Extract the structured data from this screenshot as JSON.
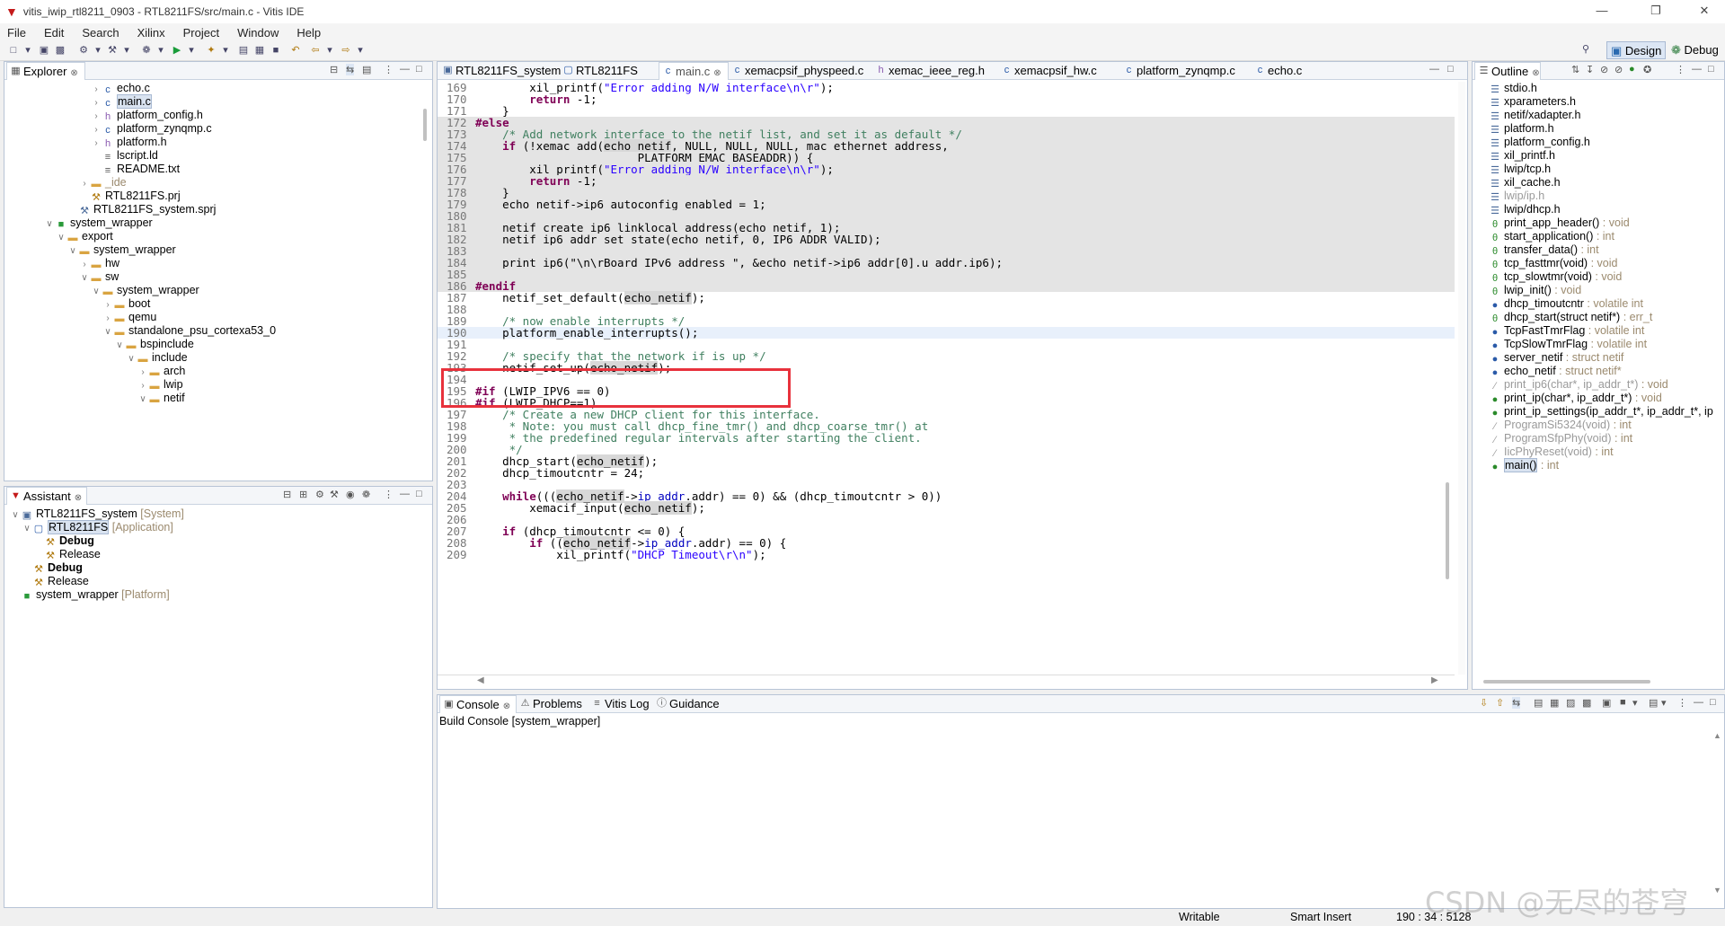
{
  "window": {
    "title": "vitis_iwip_rtl8211_0903 - RTL8211FS/src/main.c - Vitis IDE"
  },
  "menu": [
    "File",
    "Edit",
    "Search",
    "Xilinx",
    "Project",
    "Window",
    "Help"
  ],
  "perspectives": {
    "design": "Design",
    "debug": "Debug"
  },
  "explorer": {
    "tab": "Explorer",
    "rows": [
      {
        "label": "echo.c",
        "indent": 4,
        "twisty": ">",
        "icon": "c-file-icon"
      },
      {
        "label": "main.c",
        "indent": 4,
        "twisty": ">",
        "icon": "c-file-icon",
        "selected": true
      },
      {
        "label": "platform_config.h",
        "indent": 4,
        "twisty": ">",
        "icon": "h-file-icon"
      },
      {
        "label": "platform_zynqmp.c",
        "indent": 4,
        "twisty": ">",
        "icon": "c-file-icon"
      },
      {
        "label": "platform.h",
        "indent": 4,
        "twisty": ">",
        "icon": "h-file-icon"
      },
      {
        "label": "lscript.ld",
        "indent": 4,
        "twisty": "",
        "icon": "linker-file-icon"
      },
      {
        "label": "README.txt",
        "indent": 4,
        "twisty": "",
        "icon": "text-file-icon"
      },
      {
        "label": "_ide",
        "indent": 3,
        "twisty": ">",
        "icon": "folder-icon",
        "gray": true
      },
      {
        "label": "RTL8211FS.prj",
        "indent": 3,
        "twisty": "",
        "icon": "project-file-icon"
      },
      {
        "label": "RTL8211FS_system.sprj",
        "indent": 2,
        "twisty": "",
        "icon": "system-project-file-icon"
      },
      {
        "label": "system_wrapper",
        "indent": 0,
        "twisty": "v",
        "icon": "platform-icon"
      },
      {
        "label": "export",
        "indent": 1,
        "twisty": "v",
        "icon": "folder-icon"
      },
      {
        "label": "system_wrapper",
        "indent": 2,
        "twisty": "v",
        "icon": "folder-icon"
      },
      {
        "label": "hw",
        "indent": 3,
        "twisty": ">",
        "icon": "folder-icon"
      },
      {
        "label": "sw",
        "indent": 3,
        "twisty": "v",
        "icon": "folder-icon"
      },
      {
        "label": "system_wrapper",
        "indent": 4,
        "twisty": "v",
        "icon": "folder-icon"
      },
      {
        "label": "boot",
        "indent": 5,
        "twisty": ">",
        "icon": "folder-icon"
      },
      {
        "label": "qemu",
        "indent": 5,
        "twisty": ">",
        "icon": "folder-icon"
      },
      {
        "label": "standalone_psu_cortexa53_0",
        "indent": 5,
        "twisty": "v",
        "icon": "folder-icon"
      },
      {
        "label": "bspinclude",
        "indent": 6,
        "twisty": "v",
        "icon": "folder-icon"
      },
      {
        "label": "include",
        "indent": 7,
        "twisty": "v",
        "icon": "folder-icon"
      },
      {
        "label": "arch",
        "indent": 8,
        "twisty": ">",
        "icon": "folder-icon"
      },
      {
        "label": "lwip",
        "indent": 8,
        "twisty": ">",
        "icon": "folder-icon"
      },
      {
        "label": "netif",
        "indent": 8,
        "twisty": "v",
        "icon": "folder-icon"
      }
    ]
  },
  "assistant": {
    "tab": "Assistant",
    "rows": [
      {
        "label": "RTL8211FS_system",
        "suffix": " [System]",
        "indent": 0,
        "twisty": "v",
        "icon": "system-icon"
      },
      {
        "label": "RTL8211FS",
        "suffix": " [Application]",
        "indent": 1,
        "twisty": "v",
        "icon": "application-icon",
        "selected": true
      },
      {
        "label": "Debug",
        "suffix": "",
        "indent": 2,
        "twisty": "",
        "icon": "hammer-icon",
        "bold": true
      },
      {
        "label": "Release",
        "suffix": "",
        "indent": 2,
        "twisty": "",
        "icon": "hammer-icon"
      },
      {
        "label": "Debug",
        "suffix": "",
        "indent": 1,
        "twisty": "",
        "icon": "hammer-icon",
        "bold": true
      },
      {
        "label": "Release",
        "suffix": "",
        "indent": 1,
        "twisty": "",
        "icon": "hammer-icon"
      },
      {
        "label": "system_wrapper",
        "suffix": " [Platform]",
        "indent": 0,
        "twisty": "",
        "icon": "platform-icon"
      }
    ]
  },
  "editor": {
    "tabs": [
      {
        "label": "RTL8211FS_system",
        "icon": "system-icon"
      },
      {
        "label": "RTL8211FS",
        "icon": "application-icon"
      },
      {
        "label": "main.c",
        "icon": "c-file-icon",
        "active": true
      },
      {
        "label": "xemacpsif_physpeed.c",
        "icon": "c-file-icon"
      },
      {
        "label": "xemac_ieee_reg.h",
        "icon": "h-file-icon"
      },
      {
        "label": "xemacpsif_hw.c",
        "icon": "c-file-icon"
      },
      {
        "label": "platform_zynqmp.c",
        "icon": "c-file-icon"
      },
      {
        "label": "echo.c",
        "icon": "c-file-icon"
      }
    ],
    "lines": [
      {
        "n": "169",
        "t": "        xil_printf(\"Error adding N/W interface\\n\\r\");"
      },
      {
        "n": "170",
        "t": "        return -1;"
      },
      {
        "n": "171",
        "t": "    }"
      },
      {
        "n": "172",
        "t": "#else"
      },
      {
        "n": "173",
        "t": "    /* Add network interface to the netif_list, and set it as default */"
      },
      {
        "n": "174",
        "t": "    if (!xemac_add(echo_netif, NULL, NULL, NULL, mac_ethernet_address,"
      },
      {
        "n": "175",
        "t": "                        PLATFORM_EMAC_BASEADDR)) {"
      },
      {
        "n": "176",
        "t": "        xil_printf(\"Error adding N/W interface\\n\\r\");"
      },
      {
        "n": "177",
        "t": "        return -1;"
      },
      {
        "n": "178",
        "t": "    }"
      },
      {
        "n": "179",
        "t": "    echo_netif->ip6_autoconfig_enabled = 1;"
      },
      {
        "n": "180",
        "t": ""
      },
      {
        "n": "181",
        "t": "    netif_create_ip6_linklocal_address(echo_netif, 1);"
      },
      {
        "n": "182",
        "t": "    netif_ip6_addr_set_state(echo_netif, 0, IP6_ADDR_VALID);"
      },
      {
        "n": "183",
        "t": ""
      },
      {
        "n": "184",
        "t": "    print_ip6(\"\\n\\rBoard IPv6 address \", &echo_netif->ip6_addr[0].u_addr.ip6);"
      },
      {
        "n": "185",
        "t": ""
      },
      {
        "n": "186",
        "t": "#endif"
      },
      {
        "n": "187",
        "t": "    netif_set_default(echo_netif);"
      },
      {
        "n": "188",
        "t": ""
      },
      {
        "n": "189",
        "t": "    /* now enable interrupts */"
      },
      {
        "n": "190",
        "t": "    platform_enable_interrupts();"
      },
      {
        "n": "191",
        "t": ""
      },
      {
        "n": "192",
        "t": "    /* specify that the network if is up */"
      },
      {
        "n": "193",
        "t": "    netif_set_up(echo_netif);"
      },
      {
        "n": "194",
        "t": ""
      },
      {
        "n": "195",
        "t": "#if (LWIP_IPV6 == 0)"
      },
      {
        "n": "196",
        "t": "#if (LWIP_DHCP==1)"
      },
      {
        "n": "197",
        "t": "    /* Create a new DHCP client for this interface."
      },
      {
        "n": "198",
        "t": "     * Note: you must call dhcp_fine_tmr() and dhcp_coarse_tmr() at"
      },
      {
        "n": "199",
        "t": "     * the predefined regular intervals after starting the client."
      },
      {
        "n": "200",
        "t": "     */"
      },
      {
        "n": "201",
        "t": "    dhcp_start(echo_netif);"
      },
      {
        "n": "202",
        "t": "    dhcp_timoutcntr = 24;"
      },
      {
        "n": "203",
        "t": ""
      },
      {
        "n": "204",
        "t": "    while(((echo_netif->ip_addr.addr) == 0) && (dhcp_timoutcntr > 0))"
      },
      {
        "n": "205",
        "t": "        xemacif_input(echo_netif);"
      },
      {
        "n": "206",
        "t": ""
      },
      {
        "n": "207",
        "t": "    if (dhcp_timoutcntr <= 0) {"
      },
      {
        "n": "208",
        "t": "        if ((echo_netif->ip_addr.addr) == 0) {"
      },
      {
        "n": "209",
        "t": "            xil_printf(\"DHCP Timeout\\r\\n\");"
      }
    ]
  },
  "outline": {
    "tab": "Outline",
    "items": [
      {
        "name": "stdio.h",
        "type": "",
        "icon": "include-icon"
      },
      {
        "name": "xparameters.h",
        "type": "",
        "icon": "include-icon"
      },
      {
        "name": "netif/xadapter.h",
        "type": "",
        "icon": "include-icon"
      },
      {
        "name": "platform.h",
        "type": "",
        "icon": "include-icon"
      },
      {
        "name": "platform_config.h",
        "type": "",
        "icon": "include-icon"
      },
      {
        "name": "xil_printf.h",
        "type": "",
        "icon": "include-icon"
      },
      {
        "name": "lwip/tcp.h",
        "type": "",
        "icon": "include-icon"
      },
      {
        "name": "xil_cache.h",
        "type": "",
        "icon": "include-icon"
      },
      {
        "name": "lwip/ip.h",
        "type": "",
        "icon": "include-icon",
        "gray": true
      },
      {
        "name": "lwip/dhcp.h",
        "type": "",
        "icon": "include-icon"
      },
      {
        "name": "print_app_header()",
        "type": " : void",
        "icon": "function-decl-icon"
      },
      {
        "name": "start_application()",
        "type": " : int",
        "icon": "function-decl-icon"
      },
      {
        "name": "transfer_data()",
        "type": " : int",
        "icon": "function-decl-icon"
      },
      {
        "name": "tcp_fasttmr(void)",
        "type": " : void",
        "icon": "function-decl-icon"
      },
      {
        "name": "tcp_slowtmr(void)",
        "type": " : void",
        "icon": "function-decl-icon"
      },
      {
        "name": "lwip_init()",
        "type": " : void",
        "icon": "function-decl-icon"
      },
      {
        "name": "dhcp_timoutcntr",
        "type": " : volatile int",
        "icon": "variable-icon"
      },
      {
        "name": "dhcp_start(struct netif*)",
        "type": " : err_t",
        "icon": "function-decl-icon"
      },
      {
        "name": "TcpFastTmrFlag",
        "type": " : volatile int",
        "icon": "variable-icon"
      },
      {
        "name": "TcpSlowTmrFlag",
        "type": " : volatile int",
        "icon": "variable-icon"
      },
      {
        "name": "server_netif",
        "type": " : struct netif",
        "icon": "static-variable-icon"
      },
      {
        "name": "echo_netif",
        "type": " : struct netif*",
        "icon": "variable-icon"
      },
      {
        "name": "print_ip6(char*, ip_addr_t*)",
        "type": " : void",
        "icon": "inactive-function-icon",
        "gray": true
      },
      {
        "name": "print_ip(char*, ip_addr_t*)",
        "type": " : void",
        "icon": "function-icon"
      },
      {
        "name": "print_ip_settings(ip_addr_t*, ip_addr_t*, ip",
        "type": "",
        "icon": "function-icon"
      },
      {
        "name": "ProgramSi5324(void)",
        "type": " : int",
        "icon": "inactive-function-icon",
        "gray": true
      },
      {
        "name": "ProgramSfpPhy(void)",
        "type": " : int",
        "icon": "inactive-function-icon",
        "gray": true
      },
      {
        "name": "IicPhyReset(void)",
        "type": " : int",
        "icon": "inactive-function-icon",
        "gray": true
      },
      {
        "name": "main()",
        "type": " : int",
        "icon": "function-icon",
        "selected": true
      }
    ]
  },
  "console": {
    "tabs": [
      {
        "label": "Console",
        "icon": "console-icon",
        "active": true
      },
      {
        "label": "Problems",
        "icon": "problems-icon"
      },
      {
        "label": "Vitis Log",
        "icon": "log-icon"
      },
      {
        "label": "Guidance",
        "icon": "info-icon"
      }
    ],
    "title": "Build Console [system_wrapper]"
  },
  "status": {
    "writable": "Writable",
    "insert_mode": "Smart Insert",
    "position": "190 : 34 : 5128"
  },
  "watermark": "CSDN @无尽的苍穹"
}
